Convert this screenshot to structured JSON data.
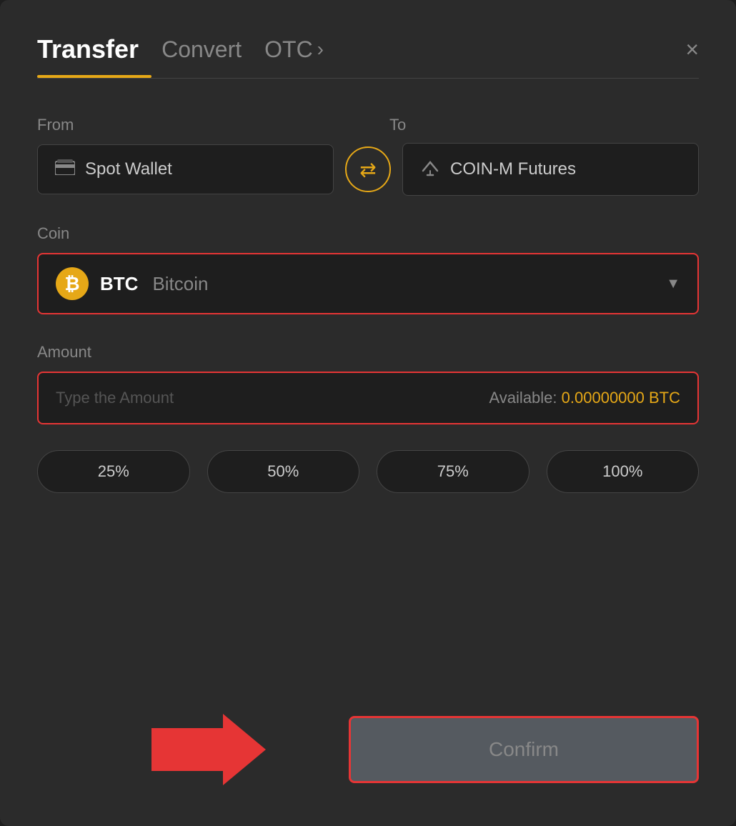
{
  "header": {
    "title": "Transfer",
    "tab_convert": "Convert",
    "tab_otc": "OTC",
    "close_label": "×"
  },
  "from_section": {
    "label": "From",
    "wallet": "Spot Wallet"
  },
  "to_section": {
    "label": "To",
    "wallet": "COIN-M Futures"
  },
  "coin_section": {
    "label": "Coin",
    "coin_symbol": "BTC",
    "coin_name": "Bitcoin"
  },
  "amount_section": {
    "label": "Amount",
    "placeholder": "Type the Amount",
    "available_label": "Available:",
    "available_value": "0.00000000 BTC"
  },
  "percent_buttons": [
    "25%",
    "50%",
    "75%",
    "100%"
  ],
  "confirm_button": "Confirm"
}
